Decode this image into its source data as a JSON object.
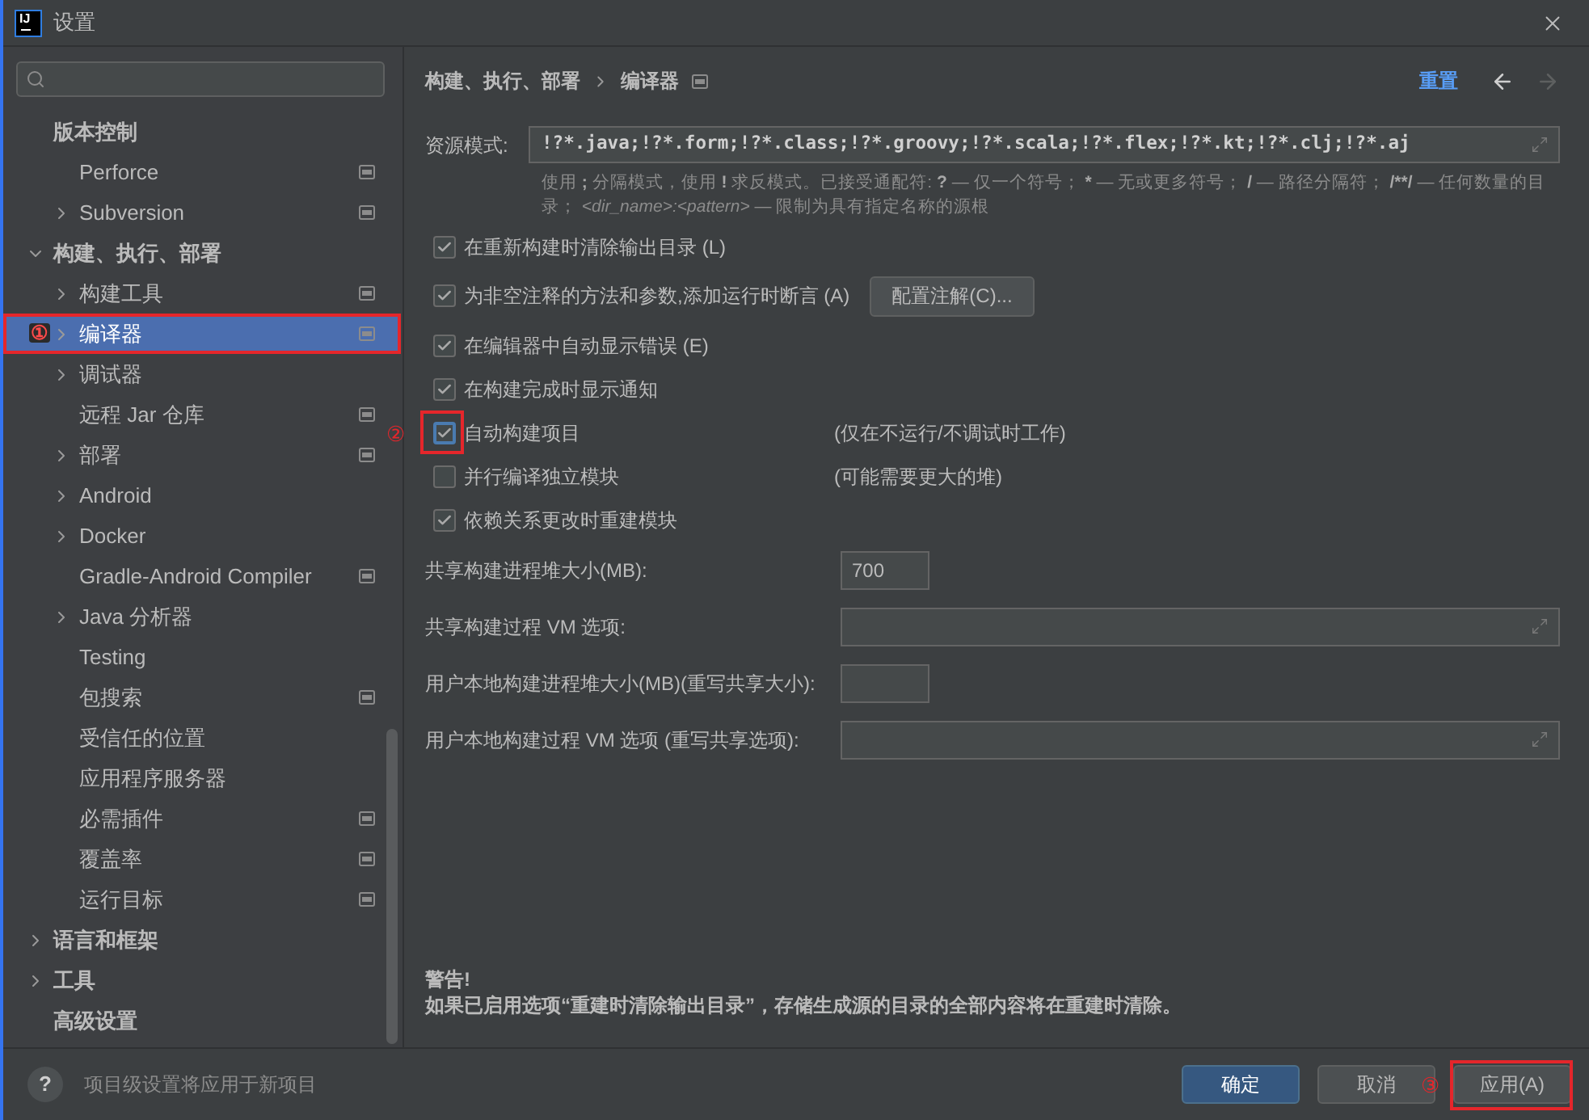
{
  "window": {
    "logo": "IJ",
    "title": "设置"
  },
  "sidebar": {
    "items": [
      {
        "label": "版本控制",
        "selected": false,
        "project_level": false,
        "children": [
          {
            "label": "Perforce",
            "selected": false,
            "project_level": true
          },
          {
            "label": "Subversion",
            "expanded": false,
            "selected": false,
            "project_level": true
          }
        ]
      },
      {
        "label": "构建、执行、部署",
        "expanded": true,
        "selected": false,
        "project_level": false,
        "children": [
          {
            "label": "构建工具",
            "expanded": false,
            "selected": false,
            "project_level": true
          },
          {
            "label": "编译器",
            "expanded": false,
            "selected": true,
            "project_level": true,
            "marker": "①"
          },
          {
            "label": "调试器",
            "expanded": false,
            "selected": false,
            "project_level": false
          },
          {
            "label": "远程 Jar 仓库",
            "selected": false,
            "project_level": true
          },
          {
            "label": "部署",
            "expanded": false,
            "selected": false,
            "project_level": true
          },
          {
            "label": "Android",
            "expanded": false,
            "selected": false,
            "project_level": false
          },
          {
            "label": "Docker",
            "expanded": false,
            "selected": false,
            "project_level": false
          },
          {
            "label": "Gradle-Android Compiler",
            "selected": false,
            "project_level": true
          },
          {
            "label": "Java 分析器",
            "expanded": false,
            "selected": false,
            "project_level": false
          },
          {
            "label": "Testing",
            "selected": false,
            "project_level": false
          },
          {
            "label": "包搜索",
            "selected": false,
            "project_level": true
          },
          {
            "label": "受信任的位置",
            "selected": false,
            "project_level": false
          },
          {
            "label": "应用程序服务器",
            "selected": false,
            "project_level": false
          },
          {
            "label": "必需插件",
            "selected": false,
            "project_level": true
          },
          {
            "label": "覆盖率",
            "selected": false,
            "project_level": true
          },
          {
            "label": "运行目标",
            "selected": false,
            "project_level": true
          }
        ]
      },
      {
        "label": "语言和框架",
        "expanded": false,
        "selected": false,
        "project_level": false
      },
      {
        "label": "工具",
        "expanded": false,
        "selected": false,
        "project_level": false
      },
      {
        "label": "高级设置",
        "selected": false,
        "project_level": false
      }
    ]
  },
  "header": {
    "breadcrumb": [
      {
        "label": "构建、执行、部署",
        "project_level": false
      },
      {
        "label": "编译器",
        "project_level": true
      }
    ],
    "reset": "重置",
    "back": {
      "disabled": false
    },
    "forward": {
      "disabled": true
    }
  },
  "resource_patterns": {
    "label": "资源模式:",
    "value": "!?*.java;!?*.form;!?*.class;!?*.groovy;!?*.scala;!?*.flex;!?*.kt;!?*.clj;!?*.aj",
    "hint": [
      {
        "text": "使用 ",
        "kind": "text"
      },
      {
        "text": ";",
        "kind": "symbol"
      },
      {
        "text": " 分隔模式，使用 ",
        "kind": "text"
      },
      {
        "text": "!",
        "kind": "symbol"
      },
      {
        "text": " 求反模式。已接受通配符: ",
        "kind": "text"
      },
      {
        "text": "?",
        "kind": "symbol"
      },
      {
        "text": " — 仅一个符号； ",
        "kind": "text"
      },
      {
        "text": "*",
        "kind": "symbol"
      },
      {
        "text": " — 无或更多符号； ",
        "kind": "text"
      },
      {
        "text": "/",
        "kind": "symbol"
      },
      {
        "text": " — 路径分隔符； ",
        "kind": "text"
      },
      {
        "text": "/**/",
        "kind": "symbol"
      },
      {
        "text": " — 任何数量的目录； ",
        "kind": "text"
      },
      {
        "text": "<dir_name>:<pattern>",
        "kind": "syntax"
      },
      {
        "text": " — 限制为具有指定名称的源根",
        "kind": "text"
      }
    ]
  },
  "options": [
    {
      "label": "在重新构建时清除输出目录 (L)",
      "checked": true,
      "focused": false
    },
    {
      "label": "为非空注释的方法和参数,添加运行时断言 (A)",
      "checked": true,
      "focused": false,
      "button": "配置注解(C)..."
    },
    {
      "label": "在编辑器中自动显示错误 (E)",
      "checked": true,
      "focused": false
    },
    {
      "label": "在构建完成时显示通知",
      "checked": true,
      "focused": false
    },
    {
      "label": "自动构建项目",
      "checked": true,
      "focused": true,
      "note": "(仅在不运行/不调试时工作)",
      "marker": "②"
    },
    {
      "label": "并行编译独立模块",
      "checked": false,
      "focused": false,
      "note": "(可能需要更大的堆)"
    },
    {
      "label": "依赖关系更改时重建模块",
      "checked": true,
      "focused": false
    }
  ],
  "fields": [
    {
      "label": "共享构建进程堆大小(MB):",
      "value": "700",
      "kind": "short"
    },
    {
      "label": "共享构建过程 VM 选项:",
      "kind": "wide"
    },
    {
      "label": "用户本地构建进程堆大小(MB)(重写共享大小):",
      "kind": "short"
    },
    {
      "label": "用户本地构建过程 VM 选项 (重写共享选项):",
      "kind": "wide"
    }
  ],
  "warning": {
    "title": "警告!",
    "text": "如果已启用选项“重建时清除输出目录”，存储生成源的目录的全部内容将在重建时清除。"
  },
  "footer": {
    "help": "?",
    "hint": "项目级设置将应用于新项目",
    "buttons": [
      {
        "label": "确定",
        "kind": "primary"
      },
      {
        "label": "取消",
        "kind": "secondary"
      },
      {
        "label": "应用(A)",
        "kind": "secondary",
        "marker": "③"
      }
    ]
  }
}
